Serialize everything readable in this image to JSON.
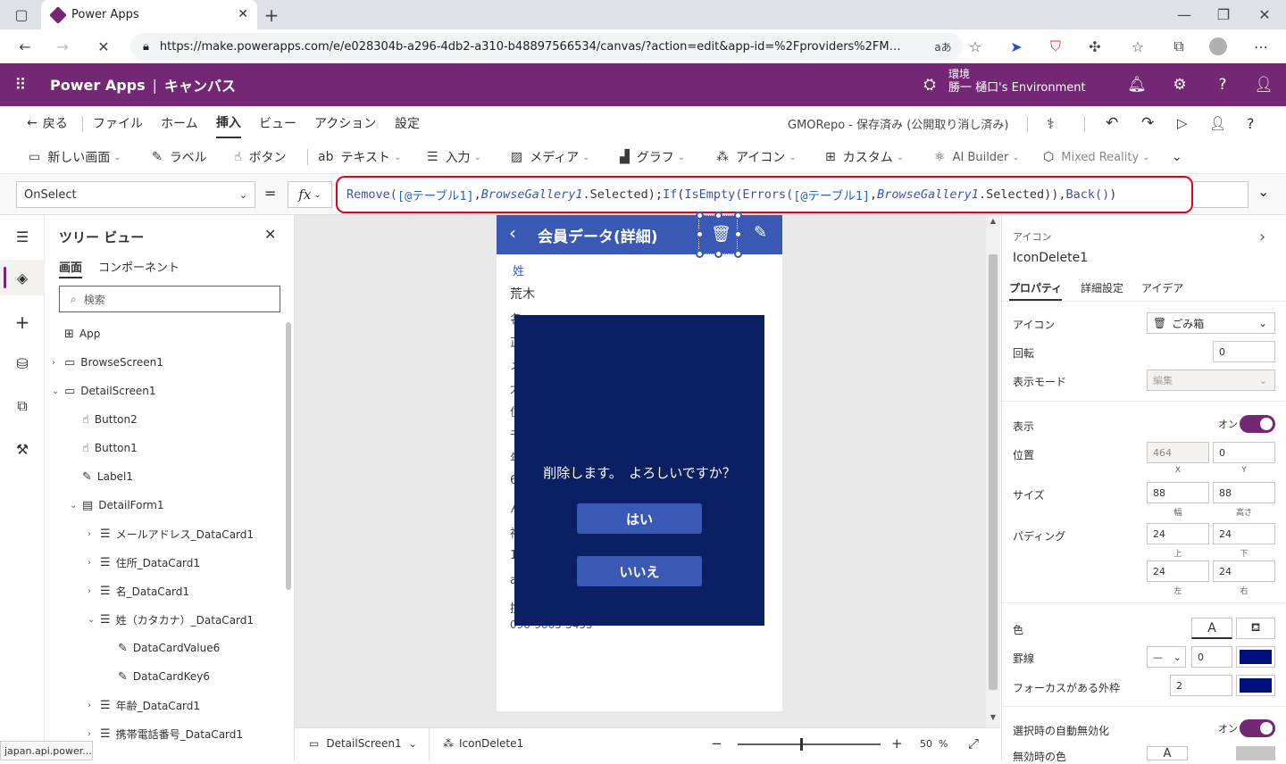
{
  "browser": {
    "tab_title": "Power Apps",
    "url": "https://make.powerapps.com/e/e028304b-a296-4db2-a310-b48897566534/canvas/?action=edit&app-id=%2Fproviders%2FMicrosoft....",
    "read_aloud": "aあ",
    "status_url": "japan.api.power..."
  },
  "header": {
    "app_name": "Power Apps",
    "separator": "|",
    "mode": "キャンバス",
    "env_label": "環境",
    "env_name": "勝一 樋口's Environment"
  },
  "menu": {
    "back": "戻る",
    "items": [
      "ファイル",
      "ホーム",
      "挿入",
      "ビュー",
      "アクション",
      "設定"
    ],
    "active": "挿入",
    "save_status": "GMORepo - 保存済み (公開取り消し済み)"
  },
  "toolbar": {
    "items": [
      "新しい画面",
      "ラベル",
      "ボタン",
      "テキスト",
      "入力",
      "メディア",
      "グラフ",
      "アイコン",
      "カスタム",
      "AI Builder",
      "Mixed Reality"
    ]
  },
  "formula_bar": {
    "property": "OnSelect",
    "equals": "=",
    "fx": "fx",
    "tokens": [
      {
        "t": "Remove(",
        "c": "fn"
      },
      {
        "t": "[@テーブル1]",
        "c": "ref"
      },
      {
        "t": ", ",
        "c": "p"
      },
      {
        "t": "BrowseGallery1",
        "c": "ctl"
      },
      {
        "t": ".Selected); ",
        "c": "p"
      },
      {
        "t": "If ",
        "c": "fn"
      },
      {
        "t": "(",
        "c": "p"
      },
      {
        "t": "IsEmpty(",
        "c": "fn"
      },
      {
        "t": "Errors(",
        "c": "fn"
      },
      {
        "t": "[@テーブル1]",
        "c": "ref"
      },
      {
        "t": ", ",
        "c": "p"
      },
      {
        "t": "BrowseGallery1",
        "c": "ctl"
      },
      {
        "t": ".Selected)), ",
        "c": "p"
      },
      {
        "t": "Back()",
        "c": "fn"
      },
      {
        "t": ")",
        "c": "p"
      }
    ]
  },
  "tree": {
    "title": "ツリー ビュー",
    "tabs": [
      "画面",
      "コンポーネント"
    ],
    "search_placeholder": "検索",
    "nodes": [
      {
        "label": "App",
        "level": 0,
        "chev": "",
        "icon": "⊞"
      },
      {
        "label": "BrowseScreen1",
        "level": 0,
        "chev": "›",
        "icon": "▭"
      },
      {
        "label": "DetailScreen1",
        "level": 0,
        "chev": "⌄",
        "icon": "▭"
      },
      {
        "label": "Button2",
        "level": 1,
        "chev": "",
        "icon": "☝"
      },
      {
        "label": "Button1",
        "level": 1,
        "chev": "",
        "icon": "☝"
      },
      {
        "label": "Label1",
        "level": 1,
        "chev": "",
        "icon": "✎"
      },
      {
        "label": "DetailForm1",
        "level": 1,
        "chev": "⌄",
        "icon": "▤"
      },
      {
        "label": "メールアドレス_DataCard1",
        "level": 2,
        "chev": "›",
        "icon": "☰"
      },
      {
        "label": "住所_DataCard1",
        "level": 2,
        "chev": "›",
        "icon": "☰"
      },
      {
        "label": "名_DataCard1",
        "level": 2,
        "chev": "›",
        "icon": "☰"
      },
      {
        "label": "姓（カタカナ）_DataCard1",
        "level": 2,
        "chev": "⌄",
        "icon": "☰"
      },
      {
        "label": "DataCardValue6",
        "level": 3,
        "chev": "",
        "icon": "✎"
      },
      {
        "label": "DataCardKey6",
        "level": 3,
        "chev": "",
        "icon": "✎"
      },
      {
        "label": "年齢_DataCard1",
        "level": 2,
        "chev": "›",
        "icon": "☰"
      },
      {
        "label": "携帯電話番号_DataCard1",
        "level": 2,
        "chev": "›",
        "icon": "☰"
      }
    ]
  },
  "screen": {
    "title": "会員データ(詳細)",
    "field_label": "姓",
    "field_value": "荒木",
    "bg_chars": [
      "名",
      "正",
      "メ",
      "大",
      "住",
      "千",
      "年",
      "6",
      "ん",
      "神",
      "1",
      "a",
      "携"
    ],
    "phone": "090-9665-5455",
    "dialog": {
      "message": "削除します。　よろしいですか？",
      "yes": "はい",
      "no": "いいえ"
    }
  },
  "status": {
    "screen": "DetailScreen1",
    "control": "IconDelete1",
    "zoom": "50",
    "zoom_unit": "%"
  },
  "properties": {
    "type": "アイコン",
    "name": "IconDelete1",
    "tabs": [
      "プロパティ",
      "詳細設定",
      "アイデア"
    ],
    "icon_label": "アイコン",
    "icon_value": "ごみ箱",
    "rotation_label": "回転",
    "rotation": "0",
    "display_mode_label": "表示モード",
    "display_mode": "編集",
    "visible_label": "表示",
    "visible_value": "オン",
    "position_label": "位置",
    "x": "464",
    "y": "0",
    "x_label": "X",
    "y_label": "Y",
    "size_label": "サイズ",
    "width": "88",
    "height": "88",
    "width_label": "幅",
    "height_label": "高さ",
    "padding_label": "パディング",
    "pad_top": "24",
    "pad_bottom": "24",
    "pad_left": "24",
    "pad_right": "24",
    "pad_top_label": "上",
    "pad_bottom_label": "下",
    "pad_left_label": "左",
    "pad_right_label": "右",
    "color_label": "色",
    "color_a": "A",
    "border_label": "罫線",
    "border_width": "0",
    "focus_label": "フォーカスがある外枠",
    "focus_width": "2",
    "auto_disable_label": "選択時の自動無効化",
    "auto_disable_value": "オン",
    "disabled_color_label": "無効時の色",
    "disabled_a": "A"
  },
  "colors": {
    "brand": "#742774",
    "screen_header": "#3a59b4",
    "dialog": "#0b1f63",
    "border_color": "#000f7a"
  }
}
